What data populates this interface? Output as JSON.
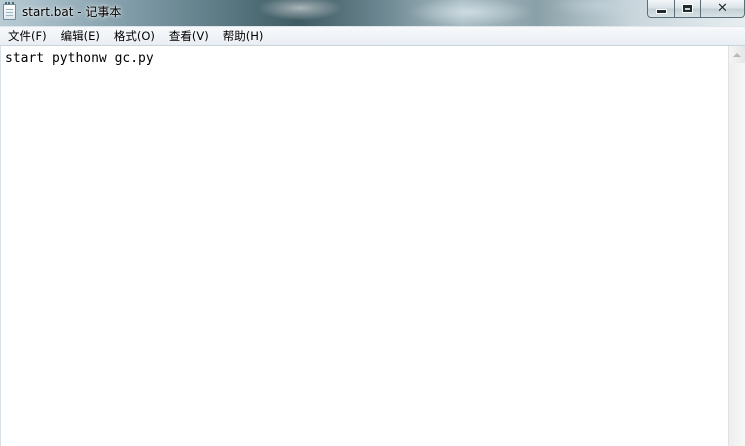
{
  "window": {
    "title": "start.bat - 记事本",
    "icon": "notepad-icon",
    "controls": {
      "minimize_icon": "minimize-icon",
      "maximize_icon": "maximize-icon",
      "close_glyph": "✕"
    }
  },
  "menu": {
    "items": [
      {
        "label": "文件(F)"
      },
      {
        "label": "编辑(E)"
      },
      {
        "label": "格式(O)"
      },
      {
        "label": "查看(V)"
      },
      {
        "label": "帮助(H)"
      }
    ]
  },
  "editor": {
    "content": "start pythonw gc.py"
  },
  "colors": {
    "text": "#000000",
    "background": "#ffffff",
    "menubar": "#e9eef3"
  }
}
